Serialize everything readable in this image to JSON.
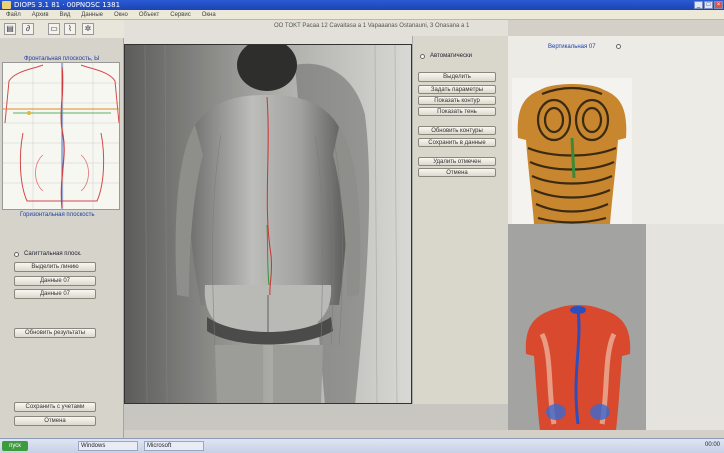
{
  "window": {
    "title": "DIOPS 3.1 81 · 00PNOSC 1381",
    "main_title": "OO TOKT Pacaa 12 Cavaitasa a 1 Vapaaanas Ostanauni, 3 Onasana a 1"
  },
  "menu": {
    "items": [
      "Файл",
      "Архив",
      "Вид",
      "Данные",
      "Окно",
      "Объект",
      "Сервис",
      "Окна"
    ]
  },
  "toolbar": {
    "icons": [
      "folder-icon",
      "stethoscope-icon",
      "window-icon",
      "chart-icon",
      "gear-icon"
    ]
  },
  "left_panel": {
    "graph_title": "Фронтальная плоскость, Ы",
    "section_title": "Горизонтальная плоскость",
    "checkbox_label": "Сагиттальная плоск.",
    "buttons": [
      "Выделить линию",
      "Данные 07",
      "Данные 07",
      "Обновить результаты",
      "Сохранить с учетами",
      "Отмена"
    ]
  },
  "mid_panel": {
    "checkbox_label": "Автоматически",
    "buttons": [
      "Выделить",
      "Задать параметры",
      "Показать контур",
      "Показать тень",
      "Обновить контуры",
      "Сохранить в данные",
      "Удалить отмечен",
      "Отмена"
    ]
  },
  "right_panel": {
    "label": "Вертикальная 07"
  },
  "taskbar": {
    "start": "пуск",
    "tasks": [
      "Windows",
      "Microsoft"
    ],
    "clock": "00:00"
  },
  "colors": {
    "titlebar": "#2a5bd6",
    "panel": "#d6d3ca",
    "accent_blue": "#1c3fa6"
  }
}
